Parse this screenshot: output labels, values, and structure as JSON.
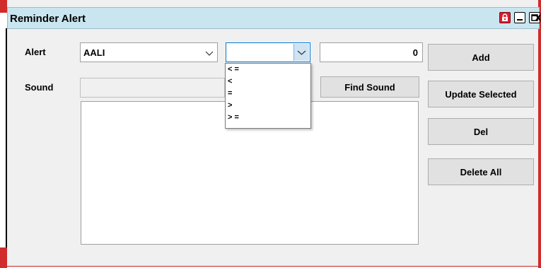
{
  "window": {
    "title": "Reminder Alert"
  },
  "titlebar_buttons": {
    "lock": "lock-icon",
    "minimize": "minimize-icon",
    "maximize": "maximize-icon",
    "close": "close-icon"
  },
  "form": {
    "alert_label": "Alert",
    "symbol_value": "AALI",
    "operator_value": "",
    "operator_options": [
      "< =",
      "<",
      "=",
      ">",
      "> ="
    ],
    "threshold_value": "0",
    "sound_label": "Sound",
    "sound_path": ""
  },
  "buttons": {
    "find_sound": "Find Sound",
    "add": "Add",
    "update_selected": "Update Selected",
    "del": "Del",
    "delete_all": "Delete All"
  },
  "alerts_list": [],
  "colors": {
    "titlebar_bg": "#c9e6f0",
    "accent_red": "#d12b2b",
    "dropdown_arrow_bg": "#cfe3f3"
  }
}
